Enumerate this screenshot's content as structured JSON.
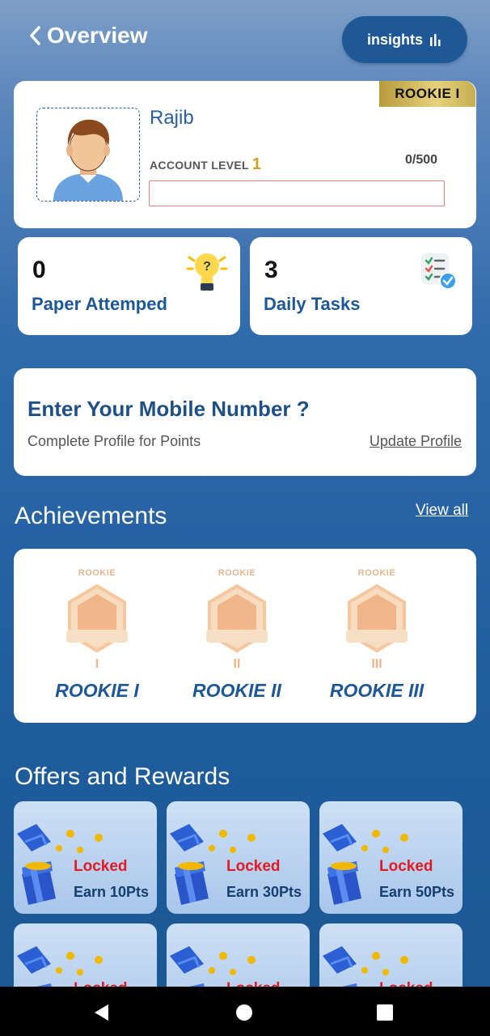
{
  "header": {
    "title": "Overview",
    "insights_label": "insights"
  },
  "profile": {
    "name": "Rajib",
    "rank_badge": "ROOKIE I",
    "account_level_label": "ACCOUNT LEVEL",
    "account_level": "1",
    "points": "0/500",
    "progress_fraction": 0
  },
  "stats": [
    {
      "value": "0",
      "label": "Paper Attemped",
      "icon": "lightbulb-question-icon"
    },
    {
      "value": "3",
      "label": "Daily Tasks",
      "icon": "checklist-icon"
    }
  ],
  "mobile_prompt": {
    "title": "Enter Your Mobile Number ?",
    "subtitle": "Complete Profile for Points",
    "link": "Update Profile"
  },
  "achievements": {
    "title": "Achievements",
    "view_all": "View all",
    "items": [
      {
        "top": "ROOKIE",
        "roman": "I",
        "name": "ROOKIE I"
      },
      {
        "top": "ROOKIE",
        "roman": "II",
        "name": "ROOKIE II"
      },
      {
        "top": "ROOKIE",
        "roman": "III",
        "name": "ROOKIE III"
      }
    ]
  },
  "offers": {
    "title": "Offers and Rewards",
    "items": [
      {
        "status": "Locked",
        "earn": "Earn 10Pts"
      },
      {
        "status": "Locked",
        "earn": "Earn 30Pts"
      },
      {
        "status": "Locked",
        "earn": "Earn 50Pts"
      },
      {
        "status": "Locked",
        "earn": ""
      },
      {
        "status": "Locked",
        "earn": ""
      },
      {
        "status": "Locked",
        "earn": ""
      }
    ]
  },
  "colors": {
    "accent": "#1e5796",
    "locked": "#e01b24",
    "badge_gold": "#c9a227"
  }
}
